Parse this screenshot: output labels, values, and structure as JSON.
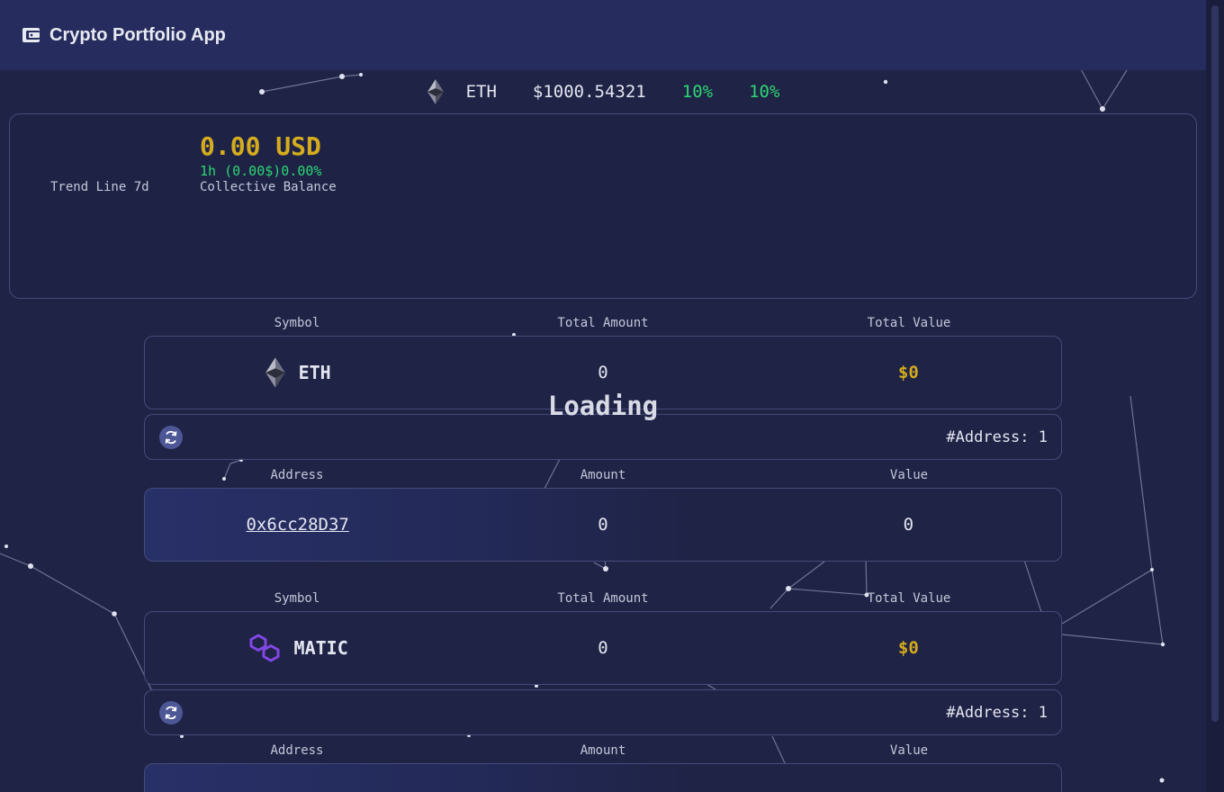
{
  "header": {
    "title": "Crypto Portfolio App",
    "icon": "wallet-icon"
  },
  "ticker": {
    "symbol": "ETH",
    "price": "$1000.54321",
    "change_1": "10%",
    "change_2": "10%",
    "icon": "ethereum-icon"
  },
  "summary": {
    "trend_label": "Trend Line 7d",
    "balance": "0.00 USD",
    "change": "1h (0.00$)0.00%",
    "balance_label": "Collective Balance"
  },
  "loading_text": "Loading",
  "colors": {
    "accent_gold": "#d4ac1e",
    "positive_green": "#2cd672",
    "background": "#1f2346",
    "header": "#262d5e"
  },
  "assets": [
    {
      "headers": {
        "symbol": "Symbol",
        "total_amount": "Total Amount",
        "total_value": "Total Value"
      },
      "symbol": "ETH",
      "icon": "ethereum-icon",
      "total_amount": "0",
      "total_value": "$0",
      "address_count": "#Address: 1",
      "address_headers": {
        "address": "Address",
        "amount": "Amount",
        "value": "Value"
      },
      "addresses": [
        {
          "address": "0x6cc28D37",
          "amount": "0",
          "value": "0"
        }
      ]
    },
    {
      "headers": {
        "symbol": "Symbol",
        "total_amount": "Total Amount",
        "total_value": "Total Value"
      },
      "symbol": "MATIC",
      "icon": "polygon-icon",
      "total_amount": "0",
      "total_value": "$0",
      "address_count": "#Address: 1",
      "address_headers": {
        "address": "Address",
        "amount": "Amount",
        "value": "Value"
      }
    }
  ]
}
